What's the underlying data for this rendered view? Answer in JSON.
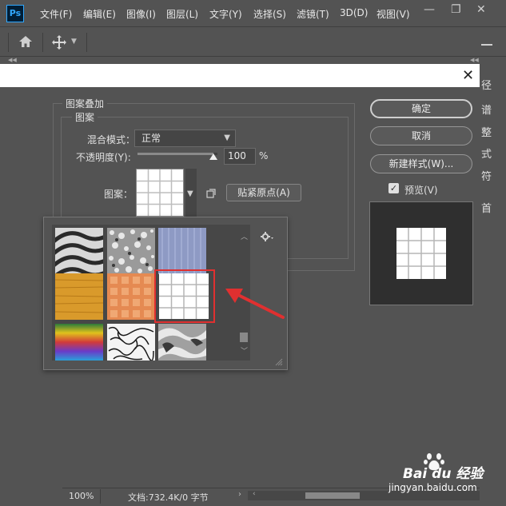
{
  "menubar": {
    "logo": "Ps",
    "items": [
      "文件(F)",
      "编辑(E)",
      "图像(I)",
      "图层(L)",
      "文字(Y)",
      "选择(S)",
      "滤镜(T)",
      "3D(D)",
      "视图(V)"
    ],
    "minimize": "—",
    "restore": "❐",
    "close": "✕"
  },
  "icons": {
    "home": "home-icon",
    "move": "move-tool-icon",
    "trash": "trash-icon",
    "gear": "gear-icon",
    "new_preset": "new-preset-icon"
  },
  "right_strip": [
    "径",
    "谱",
    "整",
    "式",
    "符",
    "首"
  ],
  "dialog": {
    "close": "✕",
    "group_title": "图案叠加",
    "subgroup_title": "图案",
    "blend_mode_label": "混合模式：",
    "blend_mode_value": "正常",
    "opacity_label": "不透明度(Y):",
    "opacity_value": "100",
    "opacity_fraction": 0.95,
    "opacity_unit": "%",
    "pattern_label": "图案：",
    "snap_origin_button": "贴紧原点(A)",
    "ok_button": "确定",
    "cancel_button": "取消",
    "new_style_button": "新建样式(W)...",
    "preview_checked": true,
    "preview_label": "预览(V)"
  },
  "pattern_picker": {
    "tiles": [
      "zebra",
      "gravel",
      "denim",
      "wood",
      "orange-dots",
      "grid",
      "rainbow",
      "marble-lines",
      "chrome"
    ],
    "selected": "grid"
  },
  "statusbar": {
    "zoom": "100%",
    "doc_info": "文档:732.4K/0 字节",
    "chevron": "›"
  },
  "watermark": {
    "brand": "Bai du 经验",
    "url": "jingyan.baidu.com"
  },
  "colors": {
    "ui_bg": "#535353",
    "highlight_frame": "#e03030",
    "annotation_arrow": "#e03030"
  }
}
